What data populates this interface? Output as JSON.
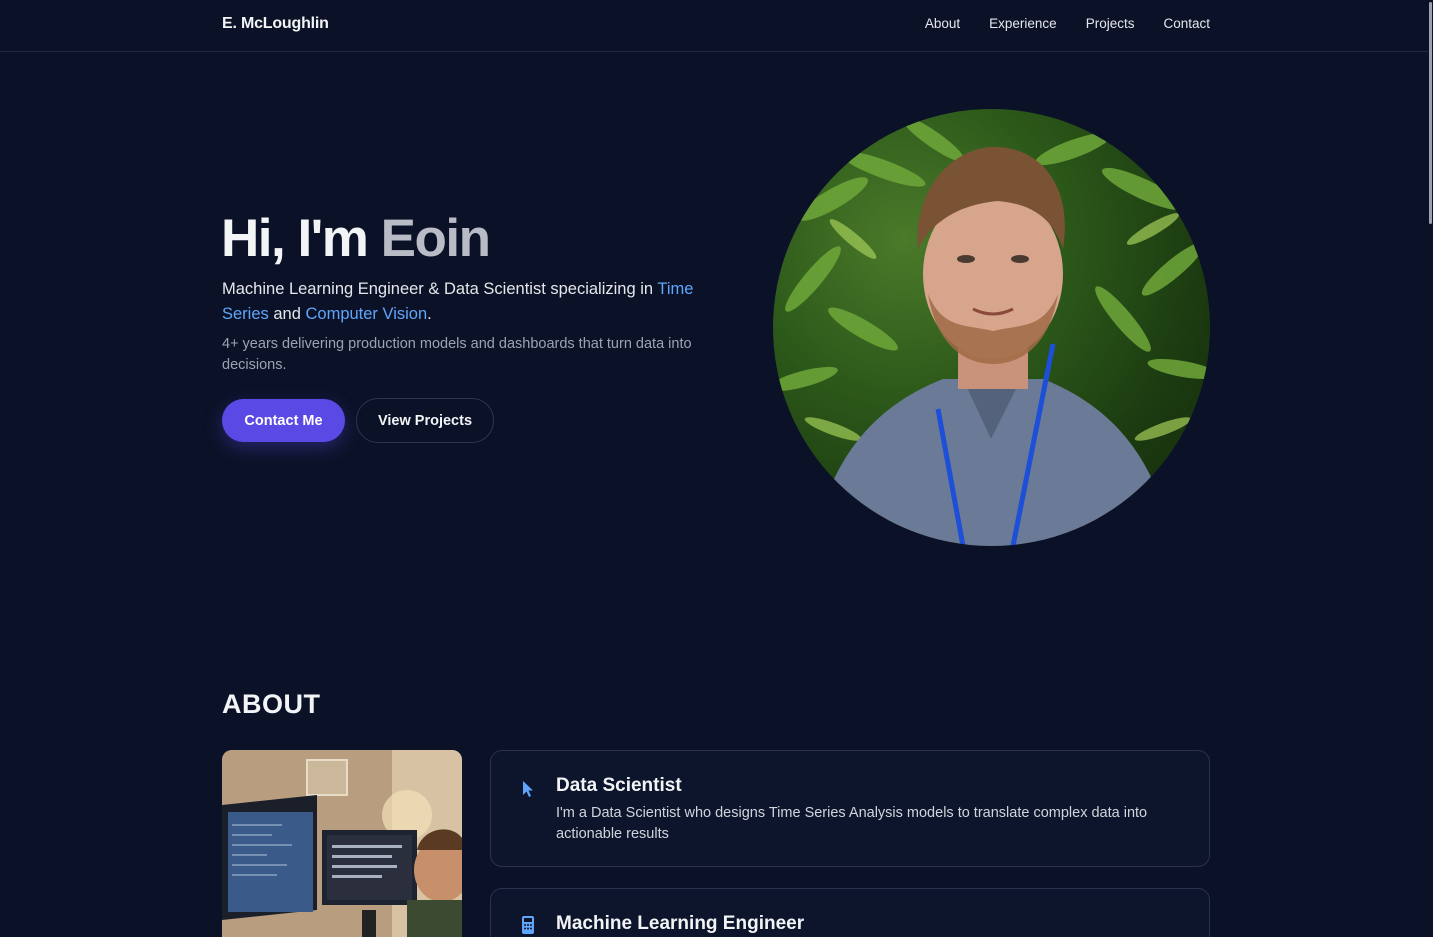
{
  "header": {
    "brand": "E. McLoughlin",
    "nav": [
      "About",
      "Experience",
      "Projects",
      "Contact"
    ]
  },
  "hero": {
    "greeting": "Hi, I'm ",
    "name": "Eoin",
    "subtitle_pre": "Machine Learning Engineer & Data Scientist specializing in ",
    "highlight1": "Time Series",
    "subtitle_mid": " and ",
    "highlight2": "Computer Vision",
    "subtitle_post": ".",
    "description": "4+ years delivering production models and dashboards that turn data into decisions.",
    "primary_button": "Contact Me",
    "secondary_button": "View Projects"
  },
  "about": {
    "title": "ABOUT",
    "cards": [
      {
        "icon": "cursor-icon",
        "title": "Data Scientist",
        "text": "I'm a Data Scientist who designs Time Series Analysis models to translate complex data into actionable results"
      },
      {
        "icon": "calculator-icon",
        "title": "Machine Learning Engineer",
        "text": ""
      }
    ]
  },
  "colors": {
    "background": "#0b1227",
    "accent": "#5b49e6",
    "highlight": "#60a5fa"
  }
}
